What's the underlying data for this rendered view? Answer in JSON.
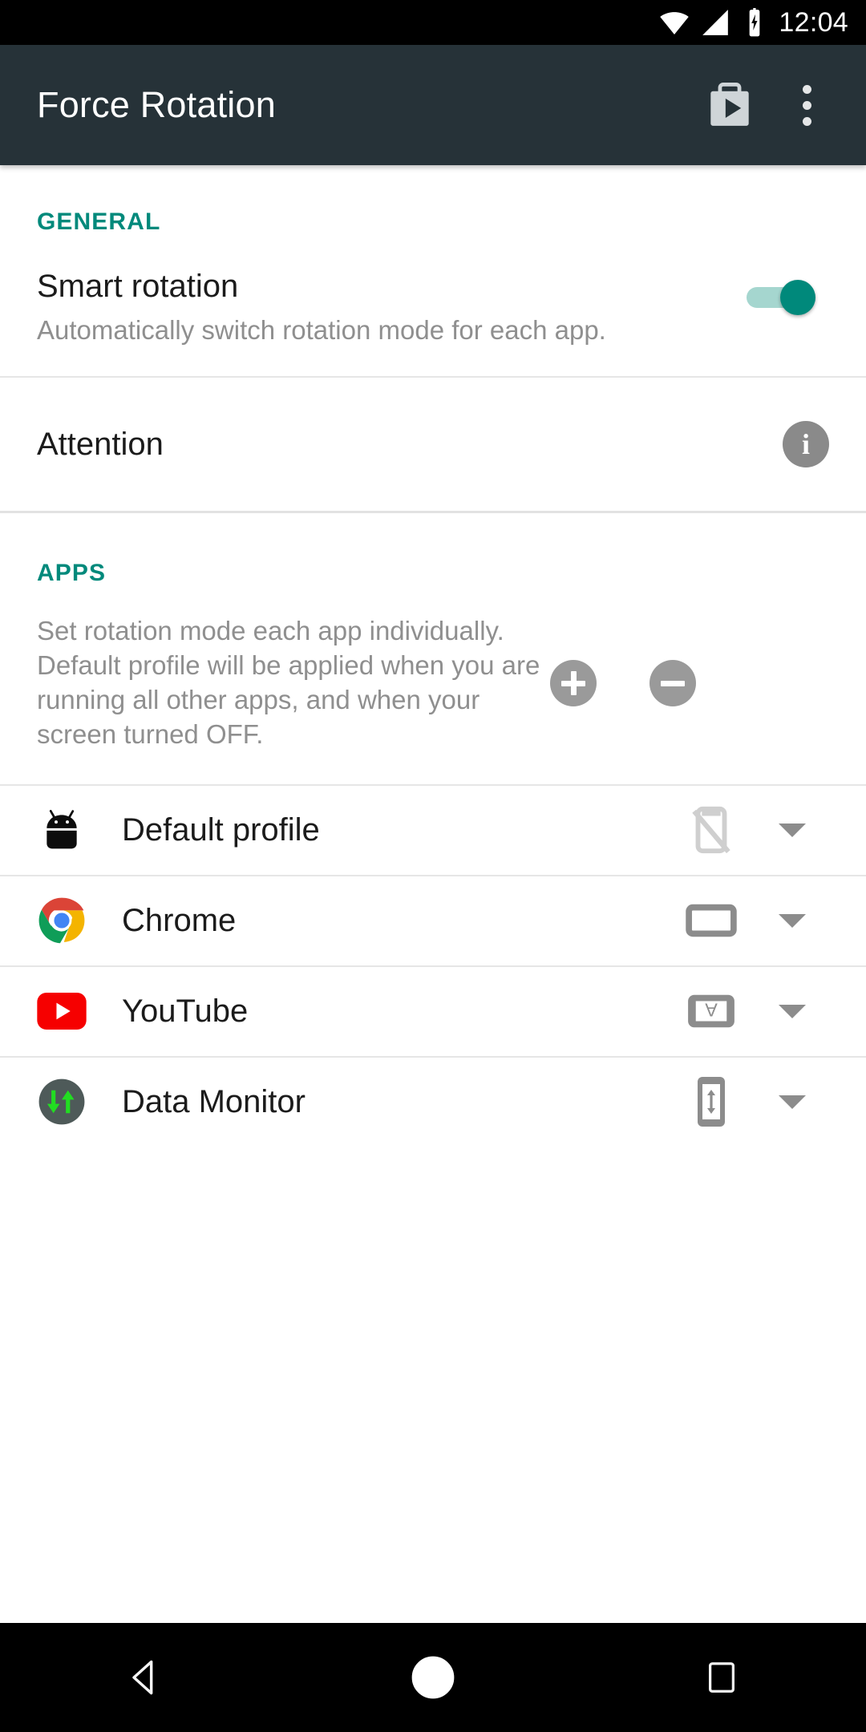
{
  "status_bar": {
    "time": "12:04",
    "icons": [
      "wifi-icon",
      "cellular-signal-icon",
      "battery-charging-icon"
    ]
  },
  "toolbar": {
    "title": "Force Rotation",
    "play_store_label": "play-store-icon",
    "overflow_label": "more-options-icon"
  },
  "general": {
    "header": "GENERAL",
    "smart_rotation": {
      "title": "Smart rotation",
      "subtitle": "Automatically switch rotation mode for each app.",
      "toggle_state": "on"
    },
    "attention": {
      "title": "Attention",
      "info_glyph": "i"
    }
  },
  "apps": {
    "header": "APPS",
    "description": "Set rotation mode each app individually. Default profile will be applied when you are running all other apps, and when your screen turned OFF.",
    "add_label": "+",
    "remove_label": "−",
    "items": [
      {
        "name": "Default profile",
        "app_icon": "android-robot-icon",
        "mode_icon": "rotation-locked-icon",
        "mode": "Rotation off"
      },
      {
        "name": "Chrome",
        "app_icon": "chrome-icon",
        "mode_icon": "landscape-icon",
        "mode": "Landscape"
      },
      {
        "name": "YouTube",
        "app_icon": "youtube-icon",
        "mode_icon": "reverse-landscape-icon",
        "mode": "Reverse landscape"
      },
      {
        "name": "Data Monitor",
        "app_icon": "data-monitor-icon",
        "mode_icon": "auto-portrait-icon",
        "mode": "Auto portrait"
      }
    ]
  },
  "nav_bar": {
    "back": "back-button",
    "home": "home-button",
    "recents": "recents-button"
  },
  "colors": {
    "toolbar_bg": "#263238",
    "accent": "#00897b",
    "status_bar_bg": "#000000",
    "nav_bar_bg": "#000000",
    "primary_text": "#1b1b1b",
    "secondary_text": "#8f8f8f",
    "icon_gray": "#9a9a9a"
  }
}
